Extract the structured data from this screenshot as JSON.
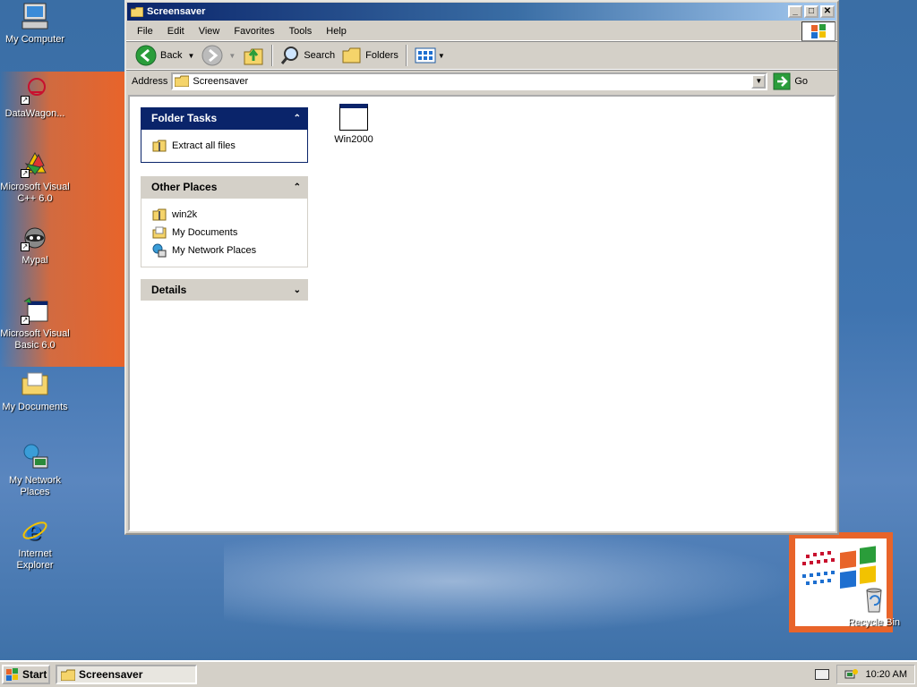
{
  "desktop": {
    "icons": [
      {
        "label": "My Computer"
      },
      {
        "label": "DataWagon..."
      },
      {
        "label": "Microsoft Visual C++ 6.0"
      },
      {
        "label": "Mypal"
      },
      {
        "label": "Microsoft Visual Basic 6.0"
      },
      {
        "label": "My Documents"
      },
      {
        "label": "My Network Places"
      },
      {
        "label": "Internet Explorer"
      },
      {
        "label": "Recycle Bin"
      }
    ]
  },
  "window": {
    "title": "Screensaver",
    "menu": [
      "File",
      "Edit",
      "View",
      "Favorites",
      "Tools",
      "Help"
    ],
    "toolbar": {
      "back": "Back",
      "search": "Search",
      "folders": "Folders"
    },
    "address": {
      "label": "Address",
      "value": "Screensaver",
      "go": "Go"
    },
    "folder_tasks": {
      "title": "Folder Tasks",
      "items": [
        "Extract all files"
      ]
    },
    "other_places": {
      "title": "Other Places",
      "items": [
        "win2k",
        "My Documents",
        "My Network Places"
      ]
    },
    "details": {
      "title": "Details"
    },
    "files": [
      {
        "name": "Win2000"
      }
    ]
  },
  "taskbar": {
    "start": "Start",
    "task": "Screensaver",
    "clock": "10:20 AM"
  },
  "colors": {
    "accent": "#0a246a",
    "desktop": "#3a6ea5",
    "orange": "#e8642a"
  }
}
